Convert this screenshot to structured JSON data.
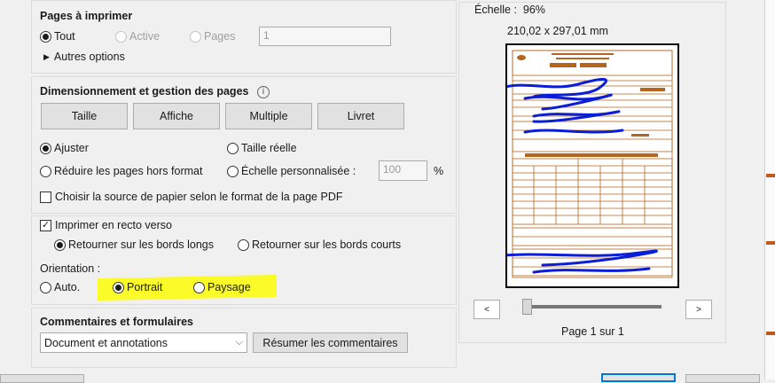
{
  "pages_section": {
    "title": "Pages à imprimer",
    "all": "Tout",
    "current": "Active",
    "pages": "Pages",
    "pages_value": "1",
    "more_options": "Autres options"
  },
  "sizing_section": {
    "title": "Dimensionnement et gestion des pages",
    "buttons": {
      "size": "Taille",
      "poster": "Affiche",
      "multiple": "Multiple",
      "booklet": "Livret"
    },
    "fit": "Ajuster",
    "actual_size": "Taille réelle",
    "shrink": "Réduire les pages hors format",
    "custom_scale": "Échelle personnalisée :",
    "custom_scale_value": "100",
    "percent": "%",
    "choose_paper": "Choisir la source de papier selon le format de la page PDF"
  },
  "duplex_section": {
    "duplex": "Imprimer en recto verso",
    "long_edge": "Retourner sur les bords longs",
    "short_edge": "Retourner sur les bords courts",
    "orientation_label": "Orientation :",
    "auto": "Auto.",
    "portrait": "Portrait",
    "landscape": "Paysage"
  },
  "comments_section": {
    "title": "Commentaires et formulaires",
    "select_value": "Document et annotations",
    "summarize": "Résumer les commentaires"
  },
  "preview": {
    "scale": "Échelle :  96%",
    "dimensions": "210,02 x 297,01 mm",
    "page_counter": "Page 1 sur 1",
    "prev": "<",
    "next": ">"
  },
  "colors": {
    "highlight": "#fbfb2a",
    "form_brown": "#b5651d",
    "scribble_blue": "#0a1ed8",
    "accent": "#0078d7"
  },
  "icons": [
    "info-icon",
    "triangle-right-icon",
    "chevron-down-icon"
  ]
}
